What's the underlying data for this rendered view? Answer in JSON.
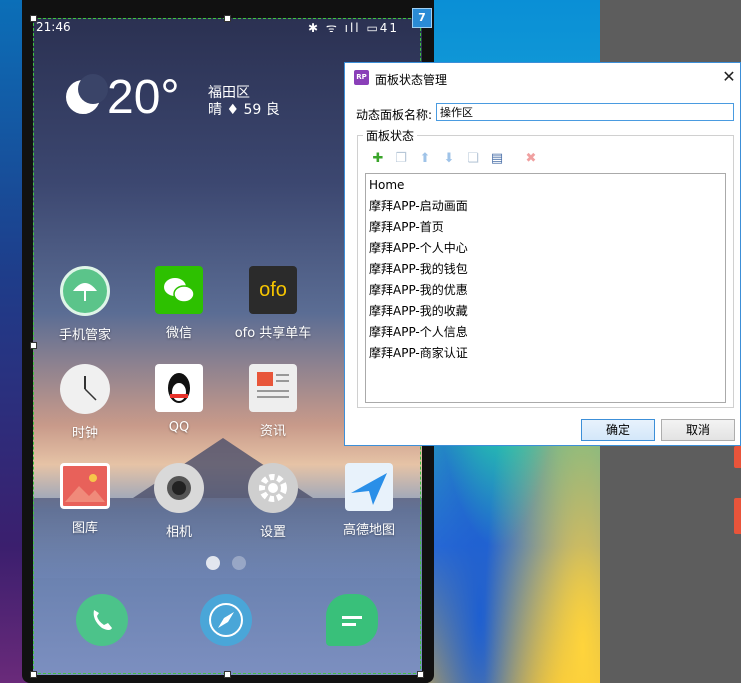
{
  "phone": {
    "status_time": "21:46",
    "status_icons": "✱ ᯤ ıll ▭41",
    "selection_badge": "7",
    "weather": {
      "temperature": "20°",
      "location": "福田区",
      "aqi": "晴 ♦ 59 良"
    },
    "apps_row1": [
      {
        "label": "手机管家",
        "icon": "umbrella-icon",
        "color": "#5bc48a"
      },
      {
        "label": "微信",
        "icon": "wechat-icon",
        "color": "#2dc100"
      },
      {
        "label": "ofo 共享单车",
        "icon": "ofo-icon",
        "color": "#2b2b2b"
      }
    ],
    "apps_row2": [
      {
        "label": "时钟",
        "icon": "clock-icon",
        "color": "#f0f0f0"
      },
      {
        "label": "QQ",
        "icon": "qq-icon",
        "color": "#ffffff"
      },
      {
        "label": "资讯",
        "icon": "news-icon",
        "color": "#eeeeee"
      }
    ],
    "apps_row3": [
      {
        "label": "图库",
        "icon": "gallery-icon",
        "color": "#e8615a"
      },
      {
        "label": "相机",
        "icon": "camera-icon",
        "color": "#d9d9d9"
      },
      {
        "label": "设置",
        "icon": "settings-icon",
        "color": "#cfcfcf"
      },
      {
        "label": "高德地图",
        "icon": "map-icon",
        "color": "#4fa8f0"
      }
    ],
    "dock": [
      {
        "icon": "phone-icon",
        "color": "#4cc38a"
      },
      {
        "icon": "browser-icon",
        "color": "#4aa6d8"
      },
      {
        "icon": "message-icon",
        "color": "#39c07a"
      }
    ]
  },
  "dialog": {
    "title": "面板状态管理",
    "logo": "RP",
    "close": "✕",
    "name_label": "动态面板名称:",
    "name_value": "操作区",
    "group_title": "面板状态",
    "toolbar": [
      {
        "icon": "add-icon",
        "glyph": "✚",
        "color": "#3aa52a"
      },
      {
        "icon": "duplicate-icon",
        "glyph": "❐",
        "color": "#b8c8d8"
      },
      {
        "icon": "move-up-icon",
        "glyph": "⬆",
        "color": "#9fc3e8"
      },
      {
        "icon": "move-down-icon",
        "glyph": "⬇",
        "color": "#9fc3e8"
      },
      {
        "icon": "edit-state-icon",
        "glyph": "❏",
        "color": "#b8c8d8"
      },
      {
        "icon": "edit-all-icon",
        "glyph": "▤",
        "color": "#4a6fa8"
      },
      {
        "icon": "delete-icon",
        "glyph": "✖",
        "color": "#f0a0a0"
      }
    ],
    "states": [
      "Home",
      "摩拜APP-启动画面",
      "摩拜APP-首页",
      "摩拜APP-个人中心",
      "摩拜APP-我的钱包",
      "摩拜APP-我的优惠",
      "摩拜APP-我的收藏",
      "摩拜APP-个人信息",
      "摩拜APP-商家认证"
    ],
    "ok_label": "确定",
    "cancel_label": "取消"
  }
}
